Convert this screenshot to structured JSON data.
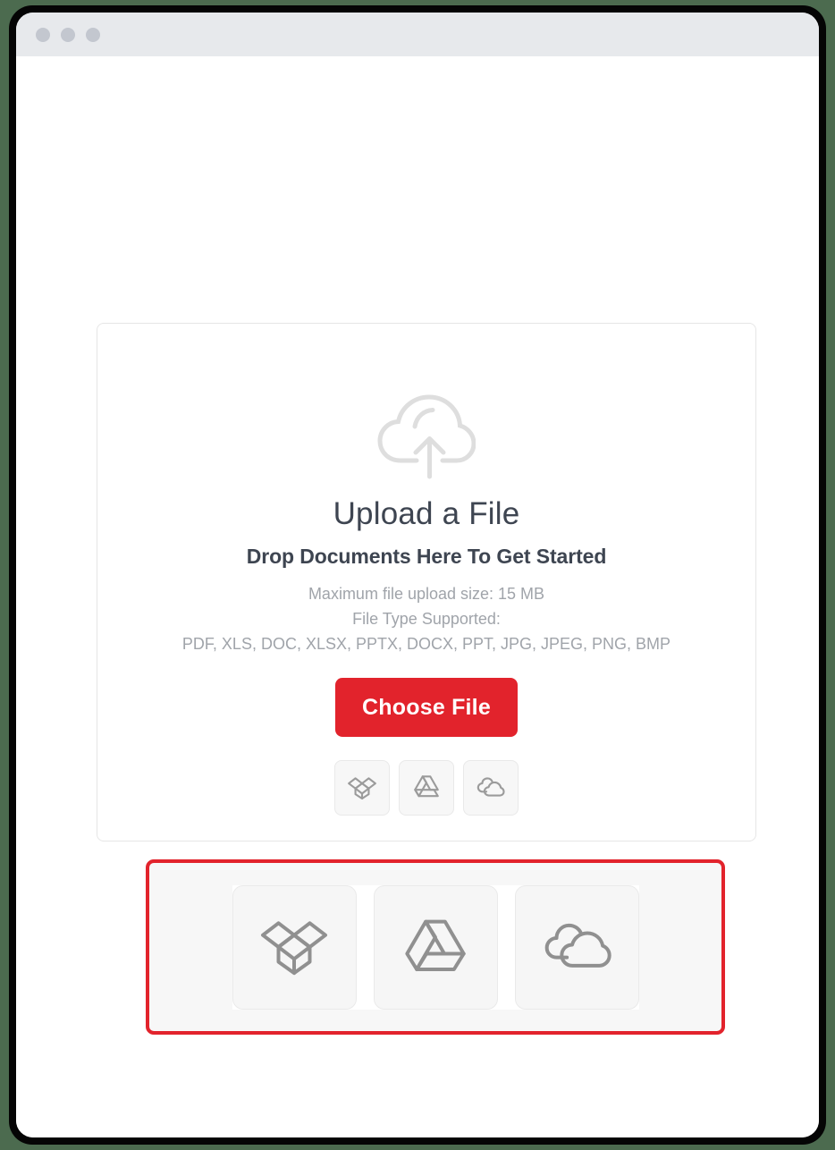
{
  "window": {
    "traffic_lights": [
      "close-dot",
      "minimize-dot",
      "maximize-dot"
    ],
    "chrome_color": "#e7e9ec"
  },
  "upload": {
    "cloud_icon": "cloud-upload-icon",
    "title": "Upload a File",
    "subtitle": "Drop Documents Here To Get Started",
    "max_size_text": "Maximum file upload size: 15 MB",
    "file_type_label": "File Type Supported:",
    "file_types": "PDF, XLS, DOC, XLSX, PPTX, DOCX, PPT, JPG, JPEG, PNG, BMP",
    "choose_file_label": "Choose File",
    "accent_color": "#e2232c",
    "title_color": "#3e4551",
    "muted_color": "#a0a4aa"
  },
  "cloud_services": [
    {
      "id": "dropbox",
      "icon": "dropbox-icon"
    },
    {
      "id": "google-drive",
      "icon": "google-drive-icon"
    },
    {
      "id": "onedrive",
      "icon": "onedrive-icon"
    }
  ],
  "highlight": {
    "border_color": "#e2232c",
    "background": "#f7f7f7"
  }
}
